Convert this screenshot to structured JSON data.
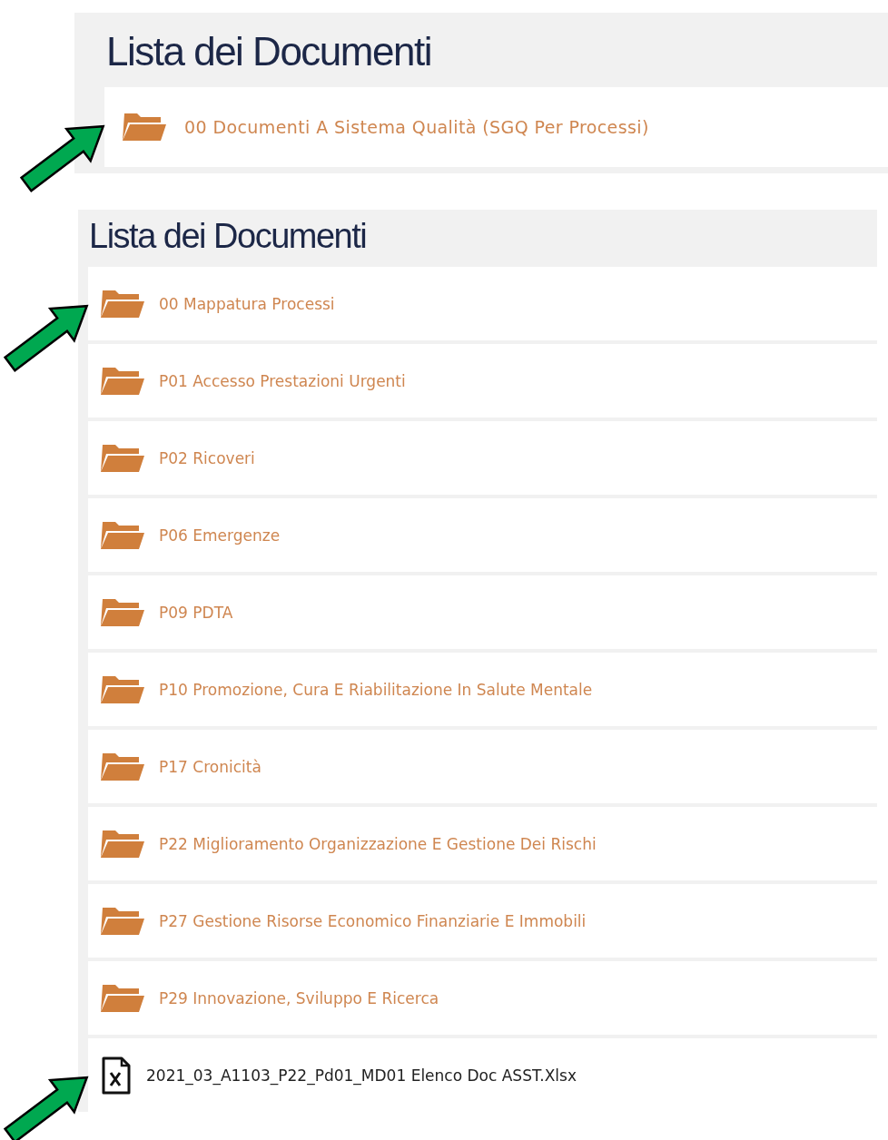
{
  "panels": [
    {
      "title": "Lista dei Documenti",
      "items": [
        {
          "kind": "folder",
          "label": "00 Documenti A Sistema Qualità (SGQ Per Processi)",
          "pointed": true
        }
      ]
    },
    {
      "title": "Lista dei Documenti",
      "items": [
        {
          "kind": "folder",
          "label": "00 Mappatura Processi",
          "pointed": true
        },
        {
          "kind": "folder",
          "label": "P01 Accesso Prestazioni Urgenti",
          "pointed": false
        },
        {
          "kind": "folder",
          "label": "P02 Ricoveri",
          "pointed": false
        },
        {
          "kind": "folder",
          "label": "P06 Emergenze",
          "pointed": false
        },
        {
          "kind": "folder",
          "label": "P09 PDTA",
          "pointed": false
        },
        {
          "kind": "folder",
          "label": "P10 Promozione, Cura E Riabilitazione In Salute Mentale",
          "pointed": false
        },
        {
          "kind": "folder",
          "label": "P17 Cronicità",
          "pointed": false
        },
        {
          "kind": "folder",
          "label": "P22 Miglioramento Organizzazione E Gestione Dei Rischi",
          "pointed": false
        },
        {
          "kind": "folder",
          "label": "P27 Gestione Risorse Economico Finanziarie E Immobili",
          "pointed": false
        },
        {
          "kind": "folder",
          "label": "P29 Innovazione, Sviluppo E Ricerca",
          "pointed": false
        },
        {
          "kind": "file",
          "label": "2021_03_A1103_P22_Pd01_MD01 Elenco Doc ASST.Xlsx",
          "pointed": true
        }
      ]
    }
  ]
}
